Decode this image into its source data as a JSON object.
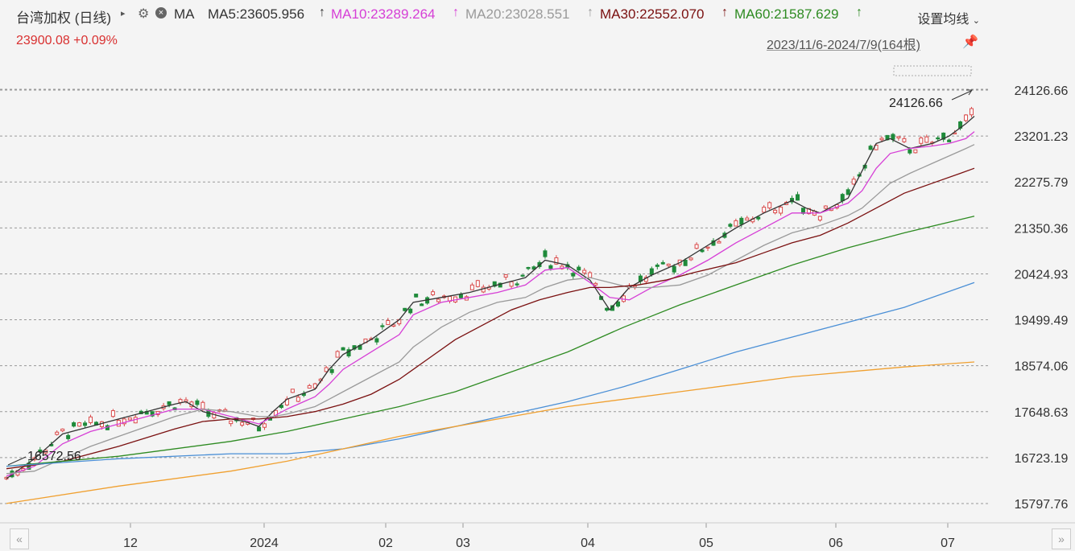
{
  "header": {
    "title": "台湾加权 (日线)",
    "ma_label": "MA",
    "ma_values": [
      {
        "label": "MA5:23605.956",
        "arrow": "↑",
        "color": "#333333"
      },
      {
        "label": "MA10:23289.264",
        "arrow": "↑",
        "color": "#d63fd6"
      },
      {
        "label": "MA20:23028.551",
        "arrow": "↑",
        "color": "#9a9a9a"
      },
      {
        "label": "MA30:22552.070",
        "arrow": "↑",
        "color": "#7a1010"
      },
      {
        "label": "MA60:21587.629",
        "arrow": "↑",
        "color": "#2e8b22"
      }
    ],
    "price_line": "23900.08 +0.09%",
    "settings_label": "设置均线",
    "range_label": "2023/11/6-2024/7/9(164根)",
    "icons": {
      "expand": "triangle-right-icon",
      "gear": "gear-icon",
      "close": "close-icon",
      "pin": "pin-icon",
      "dropdown": "chevron-down-icon"
    }
  },
  "navigation": {
    "left": "«",
    "right": "»"
  },
  "colors": {
    "up": "#d94a4a",
    "down": "#1f8a3a",
    "ma5": "#333333",
    "ma10": "#d63fd6",
    "ma20": "#9a9a9a",
    "ma30": "#7a1010",
    "ma60": "#2e8b22",
    "ma120": "#4a8fd6",
    "ma250": "#f0a030",
    "grid": "#999999"
  },
  "chart_data": {
    "type": "candlestick",
    "y_ticks": [
      24126.66,
      23201.23,
      22275.79,
      21350.36,
      20424.93,
      19499.49,
      18574.06,
      17648.63,
      16723.19,
      15797.76
    ],
    "ylim": [
      15797.76,
      24126.66
    ],
    "x_tick_labels": [
      "12",
      "2024",
      "02",
      "03",
      "04",
      "05",
      "06",
      "07"
    ],
    "annotations": {
      "max": "24126.66",
      "min": "16572.56"
    },
    "ma_series": [
      {
        "name": "MA5",
        "color": "#333333",
        "points": [
          [
            0,
            16300
          ],
          [
            10,
            16700
          ],
          [
            20,
            17200
          ],
          [
            30,
            17350
          ],
          [
            40,
            17500
          ],
          [
            50,
            17650
          ],
          [
            60,
            17800
          ],
          [
            64,
            17850
          ],
          [
            70,
            17650
          ],
          [
            80,
            17500
          ],
          [
            85,
            17450
          ],
          [
            90,
            17350
          ],
          [
            95,
            17650
          ],
          [
            100,
            17900
          ],
          [
            110,
            18100
          ],
          [
            115,
            18500
          ],
          [
            120,
            18800
          ],
          [
            130,
            19100
          ],
          [
            140,
            19500
          ],
          [
            145,
            19850
          ],
          [
            155,
            19950
          ],
          [
            165,
            20050
          ],
          [
            175,
            20200
          ],
          [
            185,
            20350
          ],
          [
            192,
            20700
          ],
          [
            200,
            20600
          ],
          [
            208,
            20300
          ],
          [
            215,
            19700
          ],
          [
            222,
            20150
          ],
          [
            230,
            20400
          ],
          [
            240,
            20650
          ],
          [
            250,
            21000
          ],
          [
            260,
            21350
          ],
          [
            270,
            21650
          ],
          [
            280,
            21900
          ],
          [
            285,
            21750
          ],
          [
            290,
            21650
          ],
          [
            300,
            21950
          ],
          [
            305,
            22500
          ],
          [
            310,
            23050
          ],
          [
            315,
            23150
          ],
          [
            322,
            22950
          ],
          [
            330,
            23050
          ],
          [
            336,
            23200
          ],
          [
            342,
            23450
          ],
          [
            345,
            23600
          ]
        ]
      },
      {
        "name": "MA10",
        "color": "#d63fd6",
        "points": [
          [
            0,
            16350
          ],
          [
            10,
            16550
          ],
          [
            20,
            17000
          ],
          [
            30,
            17250
          ],
          [
            40,
            17400
          ],
          [
            50,
            17550
          ],
          [
            60,
            17700
          ],
          [
            70,
            17700
          ],
          [
            80,
            17550
          ],
          [
            90,
            17400
          ],
          [
            95,
            17550
          ],
          [
            100,
            17700
          ],
          [
            110,
            17950
          ],
          [
            115,
            18200
          ],
          [
            120,
            18500
          ],
          [
            130,
            18850
          ],
          [
            140,
            19200
          ],
          [
            145,
            19600
          ],
          [
            155,
            19850
          ],
          [
            165,
            19950
          ],
          [
            175,
            20050
          ],
          [
            185,
            20200
          ],
          [
            192,
            20500
          ],
          [
            200,
            20550
          ],
          [
            208,
            20250
          ],
          [
            215,
            19950
          ],
          [
            222,
            19900
          ],
          [
            230,
            20150
          ],
          [
            240,
            20400
          ],
          [
            250,
            20700
          ],
          [
            260,
            21050
          ],
          [
            270,
            21350
          ],
          [
            280,
            21650
          ],
          [
            290,
            21650
          ],
          [
            300,
            21850
          ],
          [
            305,
            22100
          ],
          [
            310,
            22550
          ],
          [
            315,
            22850
          ],
          [
            322,
            22950
          ],
          [
            330,
            23000
          ],
          [
            336,
            23050
          ],
          [
            342,
            23150
          ],
          [
            345,
            23290
          ]
        ]
      },
      {
        "name": "MA20",
        "color": "#9a9a9a",
        "points": [
          [
            0,
            16400
          ],
          [
            10,
            16450
          ],
          [
            20,
            16700
          ],
          [
            30,
            16950
          ],
          [
            40,
            17150
          ],
          [
            50,
            17350
          ],
          [
            60,
            17550
          ],
          [
            70,
            17700
          ],
          [
            80,
            17650
          ],
          [
            90,
            17550
          ],
          [
            95,
            17550
          ],
          [
            100,
            17600
          ],
          [
            110,
            17750
          ],
          [
            115,
            17900
          ],
          [
            120,
            18050
          ],
          [
            130,
            18350
          ],
          [
            140,
            18650
          ],
          [
            145,
            18950
          ],
          [
            155,
            19350
          ],
          [
            165,
            19650
          ],
          [
            175,
            19850
          ],
          [
            185,
            19950
          ],
          [
            192,
            20150
          ],
          [
            200,
            20300
          ],
          [
            208,
            20350
          ],
          [
            215,
            20250
          ],
          [
            222,
            20150
          ],
          [
            230,
            20150
          ],
          [
            240,
            20200
          ],
          [
            250,
            20400
          ],
          [
            260,
            20700
          ],
          [
            270,
            21000
          ],
          [
            280,
            21250
          ],
          [
            290,
            21400
          ],
          [
            300,
            21600
          ],
          [
            305,
            21750
          ],
          [
            310,
            22000
          ],
          [
            315,
            22250
          ],
          [
            322,
            22450
          ],
          [
            330,
            22650
          ],
          [
            336,
            22800
          ],
          [
            342,
            22950
          ],
          [
            345,
            23030
          ]
        ]
      },
      {
        "name": "MA30",
        "color": "#7a1010",
        "points": [
          [
            0,
            16500
          ],
          [
            20,
            16650
          ],
          [
            40,
            16950
          ],
          [
            60,
            17300
          ],
          [
            70,
            17450
          ],
          [
            80,
            17500
          ],
          [
            90,
            17500
          ],
          [
            100,
            17550
          ],
          [
            110,
            17650
          ],
          [
            120,
            17800
          ],
          [
            130,
            18000
          ],
          [
            140,
            18300
          ],
          [
            150,
            18700
          ],
          [
            160,
            19100
          ],
          [
            170,
            19400
          ],
          [
            180,
            19700
          ],
          [
            190,
            19900
          ],
          [
            200,
            20050
          ],
          [
            208,
            20150
          ],
          [
            215,
            20150
          ],
          [
            225,
            20200
          ],
          [
            235,
            20300
          ],
          [
            245,
            20450
          ],
          [
            260,
            20650
          ],
          [
            270,
            20850
          ],
          [
            280,
            21050
          ],
          [
            290,
            21200
          ],
          [
            300,
            21450
          ],
          [
            310,
            21750
          ],
          [
            320,
            22050
          ],
          [
            330,
            22250
          ],
          [
            340,
            22450
          ],
          [
            345,
            22552
          ]
        ]
      },
      {
        "name": "MA60",
        "color": "#2e8b22",
        "points": [
          [
            0,
            16550
          ],
          [
            40,
            16750
          ],
          [
            80,
            17050
          ],
          [
            100,
            17250
          ],
          [
            120,
            17500
          ],
          [
            140,
            17750
          ],
          [
            160,
            18050
          ],
          [
            180,
            18450
          ],
          [
            200,
            18850
          ],
          [
            220,
            19350
          ],
          [
            240,
            19800
          ],
          [
            260,
            20200
          ],
          [
            280,
            20600
          ],
          [
            300,
            20950
          ],
          [
            320,
            21250
          ],
          [
            345,
            21587
          ]
        ]
      },
      {
        "name": "MA120",
        "color": "#4a8fd6",
        "points": [
          [
            0,
            16550
          ],
          [
            40,
            16700
          ],
          [
            80,
            16800
          ],
          [
            100,
            16800
          ],
          [
            120,
            16900
          ],
          [
            140,
            17100
          ],
          [
            160,
            17350
          ],
          [
            180,
            17600
          ],
          [
            200,
            17850
          ],
          [
            220,
            18150
          ],
          [
            240,
            18500
          ],
          [
            260,
            18850
          ],
          [
            280,
            19150
          ],
          [
            300,
            19450
          ],
          [
            320,
            19750
          ],
          [
            345,
            20250
          ]
        ]
      },
      {
        "name": "MA250",
        "color": "#f0a030",
        "points": [
          [
            0,
            15800
          ],
          [
            40,
            16150
          ],
          [
            80,
            16450
          ],
          [
            100,
            16650
          ],
          [
            120,
            16900
          ],
          [
            140,
            17150
          ],
          [
            160,
            17350
          ],
          [
            180,
            17550
          ],
          [
            200,
            17750
          ],
          [
            220,
            17900
          ],
          [
            240,
            18050
          ],
          [
            260,
            18200
          ],
          [
            280,
            18350
          ],
          [
            300,
            18450
          ],
          [
            320,
            18550
          ],
          [
            345,
            18650
          ]
        ]
      }
    ]
  }
}
